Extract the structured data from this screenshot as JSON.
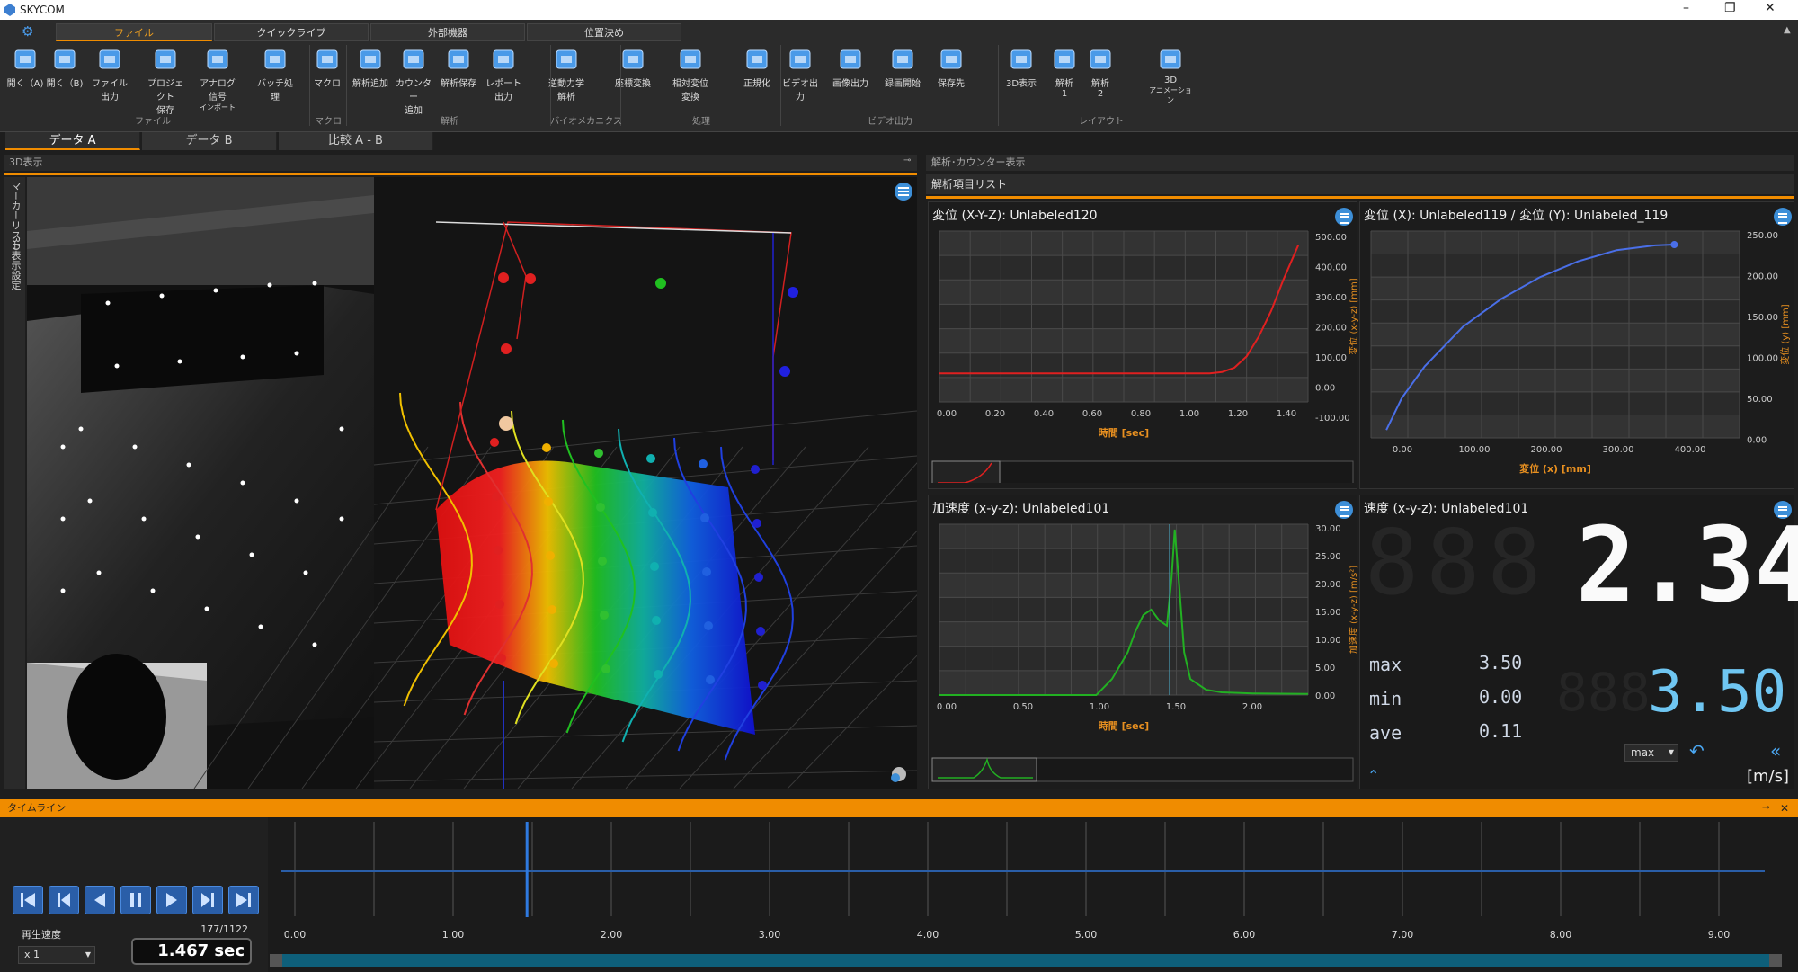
{
  "app": {
    "title": "SKYCOM",
    "icon": "skycom-icon"
  },
  "window_controls": {
    "minimize": "–",
    "maximize": "❐",
    "close": "✕"
  },
  "ribbon": {
    "tabs": [
      "ファイル",
      "クイックライブ",
      "外部機器",
      "位置決め"
    ],
    "active_tab": "ファイル",
    "buttons": [
      {
        "label1": "開く（A)",
        "label2": "",
        "icon": "open-a-icon"
      },
      {
        "label1": "開く（B)",
        "label2": "",
        "icon": "open-b-icon"
      },
      {
        "label1": "ファイル出力",
        "label2": "",
        "icon": "file-export-icon"
      },
      {
        "label1": "プロジェクト",
        "label2": "保存",
        "icon": "project-save-icon"
      },
      {
        "label1": "アナログ信号",
        "label2": "インポート",
        "icon": "analog-import-icon"
      },
      {
        "label1": "バッチ処理",
        "label2": "",
        "icon": "batch-icon"
      },
      {
        "label1": "マクロ",
        "label2": "",
        "icon": "macro-icon"
      },
      {
        "label1": "解析追加",
        "label2": "",
        "icon": "analysis-add-icon"
      },
      {
        "label1": "カウンター",
        "label2": "追加",
        "icon": "counter-add-icon"
      },
      {
        "label1": "解析保存",
        "label2": "",
        "icon": "analysis-save-icon"
      },
      {
        "label1": "レポート出力",
        "label2": "",
        "icon": "report-icon"
      },
      {
        "label1": "逆動力学解析",
        "label2": "",
        "icon": "inverse-dynamics-icon"
      },
      {
        "label1": "座標変換",
        "label2": "",
        "icon": "coordinate-transform-icon"
      },
      {
        "label1": "相対変位変換",
        "label2": "",
        "icon": "relative-displacement-icon"
      },
      {
        "label1": "正規化",
        "label2": "",
        "icon": "normalize-icon"
      },
      {
        "label1": "ビデオ出力",
        "label2": "",
        "icon": "video-export-icon"
      },
      {
        "label1": "画像出力",
        "label2": "",
        "icon": "image-export-icon"
      },
      {
        "label1": "録画開始",
        "label2": "",
        "icon": "record-icon"
      },
      {
        "label1": "保存先",
        "label2": "",
        "icon": "save-dest-icon"
      },
      {
        "label1": "3D表示",
        "label2": "",
        "icon": "view-3d-icon"
      },
      {
        "label1": "解析",
        "label2": "1",
        "icon": "layout-1-icon"
      },
      {
        "label1": "解析",
        "label2": "2",
        "icon": "layout-2-icon"
      },
      {
        "label1": "3D",
        "label2": "アニメーション",
        "icon": "animation-3d-icon"
      }
    ],
    "groups": [
      "ファイル",
      "マクロ",
      "解析",
      "バイオメカニクス",
      "処理",
      "ビデオ出力",
      "レイアウト"
    ]
  },
  "data_tabs": [
    "データ A",
    "データ B",
    "比較 A - B"
  ],
  "view3d": {
    "header": "3D表示",
    "side_tabs": [
      "マーカーリスト",
      "3D表示設定"
    ]
  },
  "analysis_panel": {
    "header": "解析･カウンター表示",
    "list_title": "解析項目リスト",
    "charts": [
      {
        "title": "変位 (X-Y-Z):  Unlabeled120",
        "xlabel": "時間 [sec]",
        "ylabel": "変位 (x-y-z) [mm]",
        "xticks": [
          "0.00",
          "0.20",
          "0.40",
          "0.60",
          "0.80",
          "1.00",
          "1.20",
          "1.40"
        ],
        "yticks": [
          "500.00",
          "400.00",
          "300.00",
          "200.00",
          "100.00",
          "0.00",
          "-100.00"
        ]
      },
      {
        "title": "変位 (X):  Unlabeled119 / 変位 (Y):  Unlabeled_119",
        "xlabel": "変位 (x) [mm]",
        "ylabel": "変位 (y) [mm]",
        "xticks": [
          "0.00",
          "100.00",
          "200.00",
          "300.00",
          "400.00"
        ],
        "yticks": [
          "250.00",
          "200.00",
          "150.00",
          "100.00",
          "50.00",
          "0.00"
        ]
      },
      {
        "title": "加速度 (x-y-z):  Unlabeled101",
        "xlabel": "時間 [sec]",
        "ylabel": "加速度 (x-y-z) [m/s²]",
        "xticks": [
          "0.00",
          "0.50",
          "1.00",
          "1.50",
          "2.00"
        ],
        "yticks": [
          "30.00",
          "25.00",
          "20.00",
          "15.00",
          "10.00",
          "5.00",
          "0.00"
        ]
      }
    ],
    "counter": {
      "title": "速度 (x-y-z):  Unlabeled101",
      "main_value": "2.34",
      "secondary_value": "3.50",
      "max_label": "max",
      "max_value": "3.50",
      "min_label": "min",
      "min_value": "0.00",
      "ave_label": "ave",
      "ave_value": "0.11",
      "select_value": "max",
      "unit": "[m/s]"
    }
  },
  "timeline": {
    "header": "タイムライン",
    "speed_label": "再生速度",
    "speed_value": "x 1",
    "frame": "177/1122",
    "time": "1.467 sec",
    "ticks": [
      "0.00",
      "1.00",
      "2.00",
      "3.00",
      "4.00",
      "5.00",
      "6.00",
      "7.00",
      "8.00",
      "9.00"
    ],
    "playhead_sec": 1.467
  },
  "chart_data": [
    {
      "type": "line",
      "title": "変位 (X-Y-Z):  Unlabeled120",
      "xlabel": "時間 [sec]",
      "ylabel": "変位 (x-y-z) [mm]",
      "xlim": [
        0,
        1.5
      ],
      "ylim": [
        -100,
        500
      ],
      "series": [
        {
          "color": "#e02020",
          "x": [
            0,
            0.2,
            0.4,
            0.6,
            0.8,
            1.0,
            1.1,
            1.15,
            1.2,
            1.25,
            1.3,
            1.35,
            1.4,
            1.46
          ],
          "y": [
            0,
            0,
            0,
            0,
            0,
            0,
            0,
            5,
            20,
            60,
            130,
            220,
            330,
            450
          ]
        }
      ]
    },
    {
      "type": "line",
      "title": "変位 (X):  Unlabeled119 / 変位 (Y):  Unlabeled_119",
      "xlabel": "変位 (x) [mm]",
      "ylabel": "変位 (y) [mm]",
      "xlim": [
        -20,
        460
      ],
      "ylim": [
        -10,
        250
      ],
      "series": [
        {
          "color": "#4a6fe8",
          "x": [
            0,
            20,
            50,
            100,
            150,
            200,
            250,
            300,
            350,
            375
          ],
          "y": [
            0,
            40,
            80,
            130,
            165,
            192,
            212,
            226,
            232,
            233
          ]
        }
      ]
    },
    {
      "type": "line",
      "title": "加速度 (x-y-z):  Unlabeled101",
      "xlabel": "時間 [sec]",
      "ylabel": "加速度 (x-y-z) [m/s²]",
      "xlim": [
        0,
        2.35
      ],
      "ylim": [
        0,
        32
      ],
      "series": [
        {
          "color": "#22b022",
          "x": [
            0,
            0.4,
            0.8,
            1.0,
            1.1,
            1.2,
            1.25,
            1.3,
            1.35,
            1.4,
            1.45,
            1.48,
            1.5,
            1.53,
            1.56,
            1.6,
            1.7,
            1.8,
            2.0,
            2.35
          ],
          "y": [
            0,
            0,
            0,
            0,
            3,
            8,
            12,
            15,
            16,
            14,
            13,
            22,
            31,
            20,
            8,
            3,
            1,
            0.5,
            0.3,
            0.2
          ]
        }
      ]
    }
  ]
}
